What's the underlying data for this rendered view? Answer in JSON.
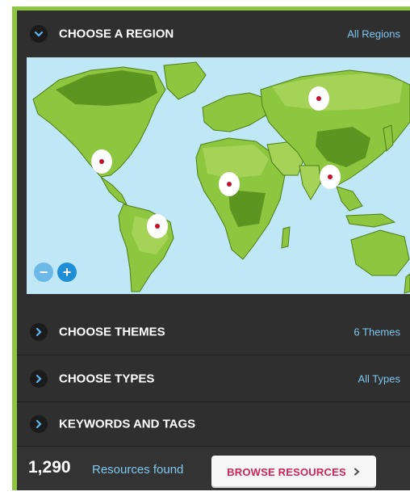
{
  "filters": {
    "region": {
      "title": "CHOOSE A REGION",
      "value": "All Regions",
      "expanded": true
    },
    "themes": {
      "title": "CHOOSE THEMES",
      "value": "6 Themes"
    },
    "types": {
      "title": "CHOOSE TYPES",
      "value": "All Types"
    },
    "keywords": {
      "title": "KEYWORDS AND TAGS"
    }
  },
  "map": {
    "markers": [
      "north-america",
      "south-america",
      "africa",
      "russia",
      "east-asia"
    ],
    "zoom_out_label": "−",
    "zoom_in_label": "+"
  },
  "results": {
    "count": "1,290",
    "label": "Resources found",
    "button_label": "BROWSE RESOURCES"
  },
  "colors": {
    "accent_green": "#8dc63f",
    "link_blue": "#7ec8f0",
    "button_text": "#d1245a",
    "ocean": "#bfe7f5",
    "land": "#8dc63f",
    "marker_dot": "#c8102e"
  }
}
